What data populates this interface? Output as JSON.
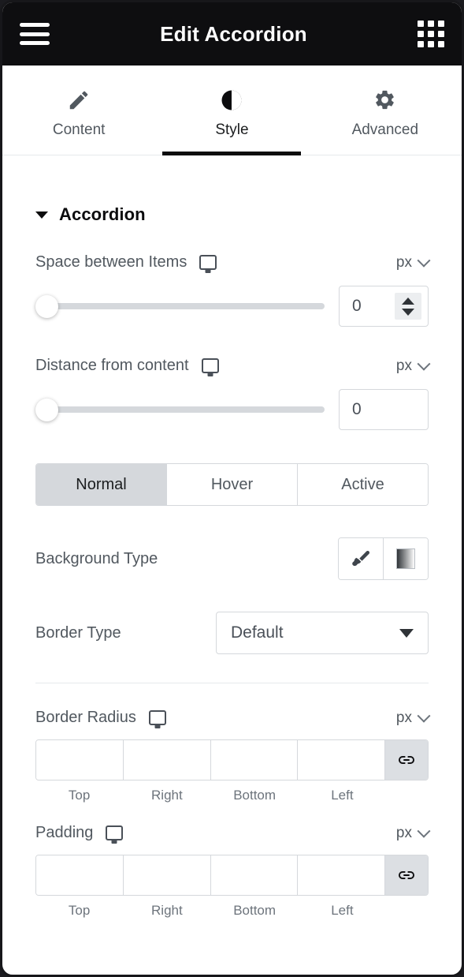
{
  "header": {
    "title": "Edit Accordion",
    "menu_icon": "hamburger-menu-icon",
    "apps_icon": "apps-grid-icon"
  },
  "tabs": [
    {
      "label": "Content",
      "icon": "pencil-icon",
      "active": false
    },
    {
      "label": "Style",
      "icon": "contrast-circle-icon",
      "active": true
    },
    {
      "label": "Advanced",
      "icon": "gear-icon",
      "active": false
    }
  ],
  "section": {
    "title": "Accordion",
    "collapsed": false
  },
  "controls": {
    "space_between_items": {
      "label": "Space between Items",
      "device_icon": "desktop-monitor-icon",
      "unit": "px",
      "value": "0",
      "slider_position_percent": 0,
      "has_spinner": true
    },
    "distance_from_content": {
      "label": "Distance from content",
      "device_icon": "desktop-monitor-icon",
      "unit": "px",
      "value": "0",
      "slider_position_percent": 0,
      "has_spinner": false
    },
    "states": {
      "options": [
        "Normal",
        "Hover",
        "Active"
      ],
      "selected": "Normal"
    },
    "background_type": {
      "label": "Background Type",
      "options": [
        {
          "name": "classic",
          "icon": "paintbrush-icon"
        },
        {
          "name": "gradient",
          "icon": "gradient-swatch-icon"
        }
      ]
    },
    "border_type": {
      "label": "Border Type",
      "value": "Default"
    },
    "border_radius": {
      "label": "Border Radius",
      "device_icon": "desktop-monitor-icon",
      "unit": "px",
      "sides": [
        "Top",
        "Right",
        "Bottom",
        "Left"
      ],
      "values": [
        "",
        "",
        "",
        ""
      ],
      "link_icon": "chain-link-icon",
      "linked": true
    },
    "padding": {
      "label": "Padding",
      "device_icon": "desktop-monitor-icon",
      "unit": "px",
      "sides": [
        "Top",
        "Right",
        "Bottom",
        "Left"
      ],
      "values": [
        "",
        "",
        "",
        ""
      ],
      "link_icon": "chain-link-icon",
      "linked": true
    }
  },
  "colors": {
    "header_bg": "#0e0e10",
    "accent_underline": "#0c0c0e",
    "label_text": "#51585f",
    "border": "#d5d8dc",
    "active_state_bg": "#d5d8dc",
    "link_button_bg": "#dcdfe3"
  }
}
